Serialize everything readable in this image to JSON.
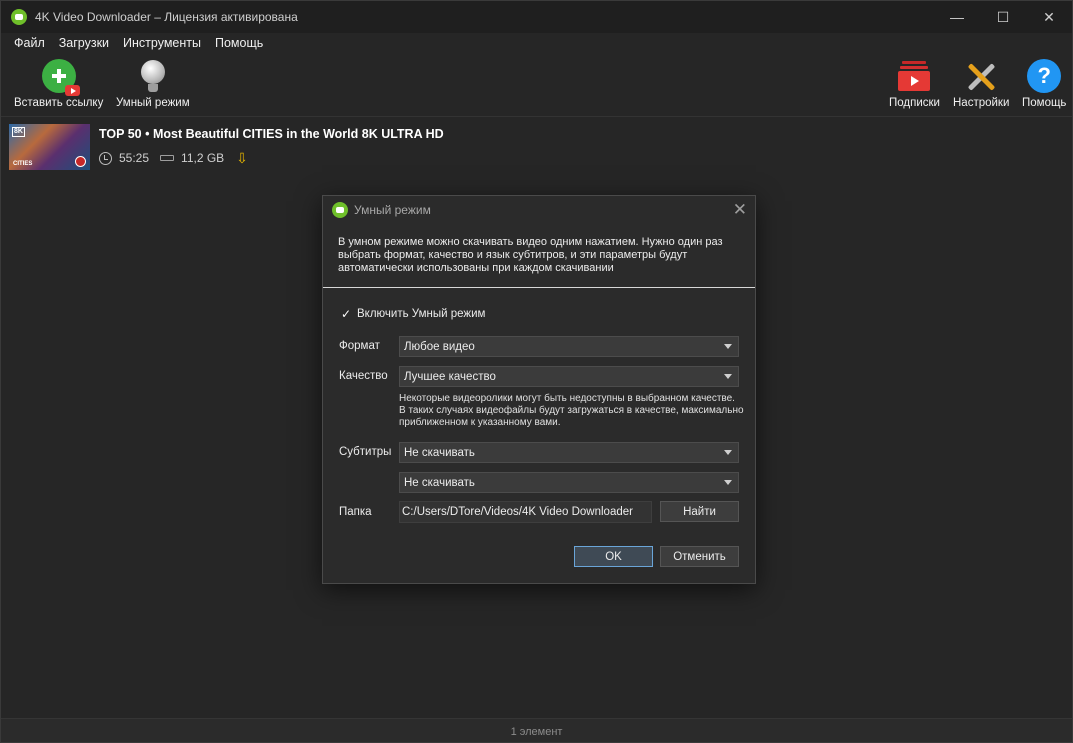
{
  "window": {
    "title": "4K Video Downloader – Лицензия активирована",
    "controls": {
      "minimize": "—",
      "maximize": "☐",
      "close": "✕"
    }
  },
  "menu": [
    "Файл",
    "Загрузки",
    "Инструменты",
    "Помощь"
  ],
  "toolbar": {
    "paste_link": "Вставить ссылку",
    "smart_mode": "Умный режим",
    "subscriptions": "Подписки",
    "settings": "Настройки",
    "help": "Помощь",
    "help_glyph": "?"
  },
  "downloads": [
    {
      "title": "TOP 50 • Most Beautiful CITIES in the World 8K ULTRA HD",
      "thumb_badge": "8K",
      "thumb_caption": "CITIES",
      "duration": "55:25",
      "size": "11,2 GB"
    }
  ],
  "status": {
    "count": "1 элемент"
  },
  "dialog": {
    "title": "Умный режим",
    "close_glyph": "✕",
    "description": "В умном режиме можно скачивать видео одним нажатием. Нужно один раз выбрать формат, качество и язык субтитров, и эти параметры будут автоматически использованы при каждом скачивании",
    "enable_checkbox": {
      "label": "Включить Умный режим",
      "checked": true,
      "mark": "✓"
    },
    "format": {
      "label": "Формат",
      "value": "Любое видео"
    },
    "quality": {
      "label": "Качество",
      "value": "Лучшее качество",
      "note": "Некоторые видеоролики могут быть недоступны в выбранном качестве. В таких случаях видеофайлы будут загружаться в качестве, максимально приближенном к указанному вами."
    },
    "subtitles": {
      "label": "Субтитры",
      "value": "Не скачивать",
      "second_value": "Не скачивать"
    },
    "folder": {
      "label": "Папка",
      "value": "C:/Users/DTore/Videos/4K Video Downloader",
      "browse_label": "Найти"
    },
    "ok_label": "OK",
    "cancel_label": "Отменить"
  },
  "colors": {
    "accent_green": "#6fbf2a",
    "download_arrow": "#e5b400",
    "help_blue": "#2196f3",
    "subscriptions_red": "#e53935"
  }
}
